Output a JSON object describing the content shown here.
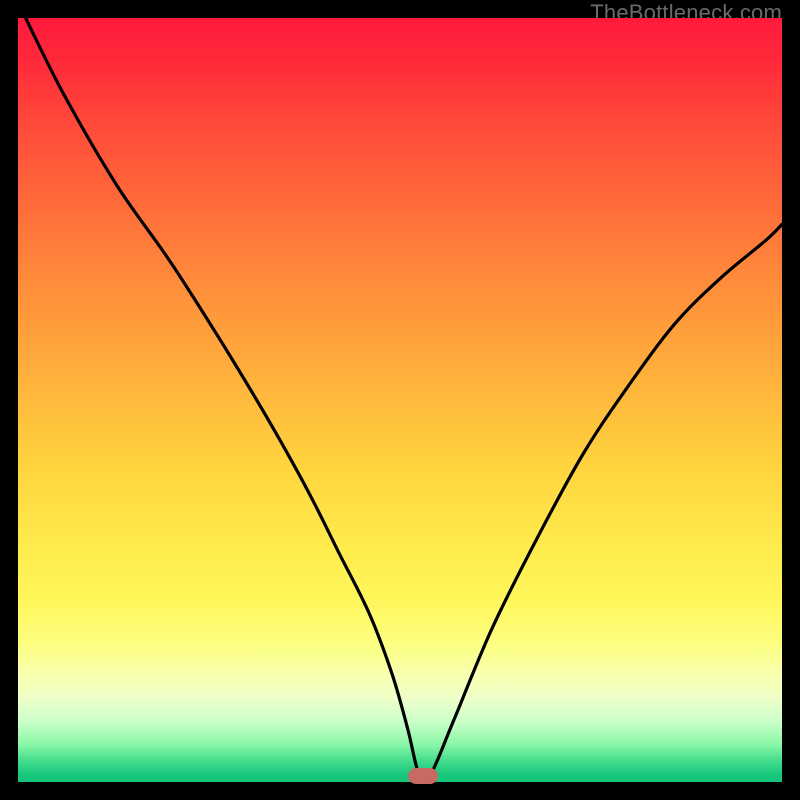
{
  "watermark": "TheBottleneck.com",
  "colors": {
    "frame": "#000000",
    "curve": "#000000",
    "marker": "#c76a62",
    "gradient_top": "#ff1a3c",
    "gradient_bottom": "#14c47a"
  },
  "chart_data": {
    "type": "line",
    "title": "",
    "xlabel": "",
    "ylabel": "",
    "xlim": [
      0,
      100
    ],
    "ylim": [
      0,
      100
    ],
    "grid": false,
    "legend": null,
    "background": "red-yellow-green vertical gradient",
    "series": [
      {
        "name": "bottleneck-curve",
        "x": [
          1,
          6,
          13,
          20,
          27,
          33,
          38,
          42,
          46,
          49,
          51,
          52.5,
          54,
          57,
          62,
          68,
          74,
          80,
          86,
          92,
          98,
          100
        ],
        "y": [
          100,
          90,
          78,
          68,
          57,
          47,
          38,
          30,
          22,
          14,
          7,
          1,
          1,
          8,
          20,
          32,
          43,
          52,
          60,
          66,
          71,
          73
        ]
      }
    ],
    "annotations": [
      {
        "name": "optimal-marker",
        "x": 53,
        "y": 0.8,
        "shape": "rounded-rect"
      }
    ]
  }
}
